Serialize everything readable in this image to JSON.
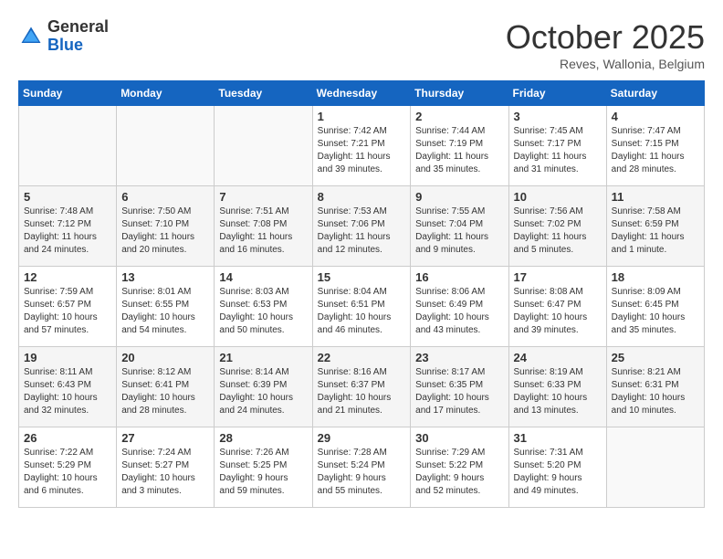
{
  "logo": {
    "general": "General",
    "blue": "Blue"
  },
  "title": "October 2025",
  "subtitle": "Reves, Wallonia, Belgium",
  "days_header": [
    "Sunday",
    "Monday",
    "Tuesday",
    "Wednesday",
    "Thursday",
    "Friday",
    "Saturday"
  ],
  "weeks": [
    [
      {
        "num": "",
        "info": ""
      },
      {
        "num": "",
        "info": ""
      },
      {
        "num": "",
        "info": ""
      },
      {
        "num": "1",
        "info": "Sunrise: 7:42 AM\nSunset: 7:21 PM\nDaylight: 11 hours\nand 39 minutes."
      },
      {
        "num": "2",
        "info": "Sunrise: 7:44 AM\nSunset: 7:19 PM\nDaylight: 11 hours\nand 35 minutes."
      },
      {
        "num": "3",
        "info": "Sunrise: 7:45 AM\nSunset: 7:17 PM\nDaylight: 11 hours\nand 31 minutes."
      },
      {
        "num": "4",
        "info": "Sunrise: 7:47 AM\nSunset: 7:15 PM\nDaylight: 11 hours\nand 28 minutes."
      }
    ],
    [
      {
        "num": "5",
        "info": "Sunrise: 7:48 AM\nSunset: 7:12 PM\nDaylight: 11 hours\nand 24 minutes."
      },
      {
        "num": "6",
        "info": "Sunrise: 7:50 AM\nSunset: 7:10 PM\nDaylight: 11 hours\nand 20 minutes."
      },
      {
        "num": "7",
        "info": "Sunrise: 7:51 AM\nSunset: 7:08 PM\nDaylight: 11 hours\nand 16 minutes."
      },
      {
        "num": "8",
        "info": "Sunrise: 7:53 AM\nSunset: 7:06 PM\nDaylight: 11 hours\nand 12 minutes."
      },
      {
        "num": "9",
        "info": "Sunrise: 7:55 AM\nSunset: 7:04 PM\nDaylight: 11 hours\nand 9 minutes."
      },
      {
        "num": "10",
        "info": "Sunrise: 7:56 AM\nSunset: 7:02 PM\nDaylight: 11 hours\nand 5 minutes."
      },
      {
        "num": "11",
        "info": "Sunrise: 7:58 AM\nSunset: 6:59 PM\nDaylight: 11 hours\nand 1 minute."
      }
    ],
    [
      {
        "num": "12",
        "info": "Sunrise: 7:59 AM\nSunset: 6:57 PM\nDaylight: 10 hours\nand 57 minutes."
      },
      {
        "num": "13",
        "info": "Sunrise: 8:01 AM\nSunset: 6:55 PM\nDaylight: 10 hours\nand 54 minutes."
      },
      {
        "num": "14",
        "info": "Sunrise: 8:03 AM\nSunset: 6:53 PM\nDaylight: 10 hours\nand 50 minutes."
      },
      {
        "num": "15",
        "info": "Sunrise: 8:04 AM\nSunset: 6:51 PM\nDaylight: 10 hours\nand 46 minutes."
      },
      {
        "num": "16",
        "info": "Sunrise: 8:06 AM\nSunset: 6:49 PM\nDaylight: 10 hours\nand 43 minutes."
      },
      {
        "num": "17",
        "info": "Sunrise: 8:08 AM\nSunset: 6:47 PM\nDaylight: 10 hours\nand 39 minutes."
      },
      {
        "num": "18",
        "info": "Sunrise: 8:09 AM\nSunset: 6:45 PM\nDaylight: 10 hours\nand 35 minutes."
      }
    ],
    [
      {
        "num": "19",
        "info": "Sunrise: 8:11 AM\nSunset: 6:43 PM\nDaylight: 10 hours\nand 32 minutes."
      },
      {
        "num": "20",
        "info": "Sunrise: 8:12 AM\nSunset: 6:41 PM\nDaylight: 10 hours\nand 28 minutes."
      },
      {
        "num": "21",
        "info": "Sunrise: 8:14 AM\nSunset: 6:39 PM\nDaylight: 10 hours\nand 24 minutes."
      },
      {
        "num": "22",
        "info": "Sunrise: 8:16 AM\nSunset: 6:37 PM\nDaylight: 10 hours\nand 21 minutes."
      },
      {
        "num": "23",
        "info": "Sunrise: 8:17 AM\nSunset: 6:35 PM\nDaylight: 10 hours\nand 17 minutes."
      },
      {
        "num": "24",
        "info": "Sunrise: 8:19 AM\nSunset: 6:33 PM\nDaylight: 10 hours\nand 13 minutes."
      },
      {
        "num": "25",
        "info": "Sunrise: 8:21 AM\nSunset: 6:31 PM\nDaylight: 10 hours\nand 10 minutes."
      }
    ],
    [
      {
        "num": "26",
        "info": "Sunrise: 7:22 AM\nSunset: 5:29 PM\nDaylight: 10 hours\nand 6 minutes."
      },
      {
        "num": "27",
        "info": "Sunrise: 7:24 AM\nSunset: 5:27 PM\nDaylight: 10 hours\nand 3 minutes."
      },
      {
        "num": "28",
        "info": "Sunrise: 7:26 AM\nSunset: 5:25 PM\nDaylight: 9 hours\nand 59 minutes."
      },
      {
        "num": "29",
        "info": "Sunrise: 7:28 AM\nSunset: 5:24 PM\nDaylight: 9 hours\nand 55 minutes."
      },
      {
        "num": "30",
        "info": "Sunrise: 7:29 AM\nSunset: 5:22 PM\nDaylight: 9 hours\nand 52 minutes."
      },
      {
        "num": "31",
        "info": "Sunrise: 7:31 AM\nSunset: 5:20 PM\nDaylight: 9 hours\nand 49 minutes."
      },
      {
        "num": "",
        "info": ""
      }
    ]
  ]
}
